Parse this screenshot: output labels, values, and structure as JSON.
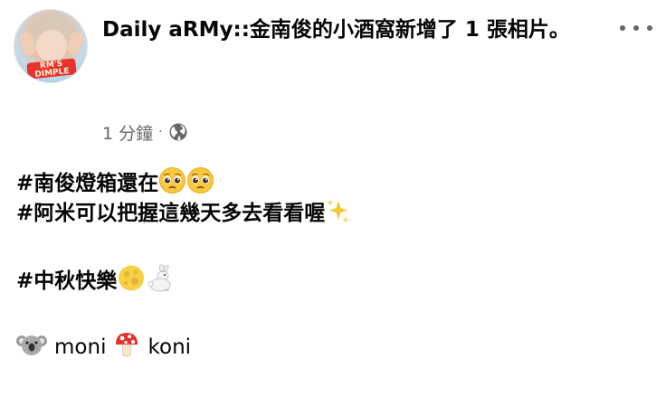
{
  "post": {
    "author": "Daily aRMy::",
    "action_text": "金南俊的小酒窩新增了 1 張相片。",
    "timestamp": "1 分鐘",
    "separator": "·",
    "avatar_sticker_text": "RM'S DIMPLE",
    "lines": [
      {
        "text": "#南俊燈箱還在",
        "emoji": [
          "pleading-face-emoji",
          "pleading-face-emoji"
        ]
      },
      {
        "text": "#阿米可以把握這幾天多去看看喔",
        "emoji": [
          "sparkles-emoji"
        ]
      },
      {
        "text": "#中秋快樂",
        "emoji": [
          "full-moon-emoji",
          "rabbit-emoji"
        ]
      },
      {
        "mentions": [
          "moni",
          "koni"
        ],
        "emoji": [
          "koala-emoji",
          "mushroom-emoji"
        ]
      }
    ]
  },
  "colors": {
    "text_primary": "#050505",
    "text_secondary": "#65676b",
    "background": "#ffffff"
  }
}
